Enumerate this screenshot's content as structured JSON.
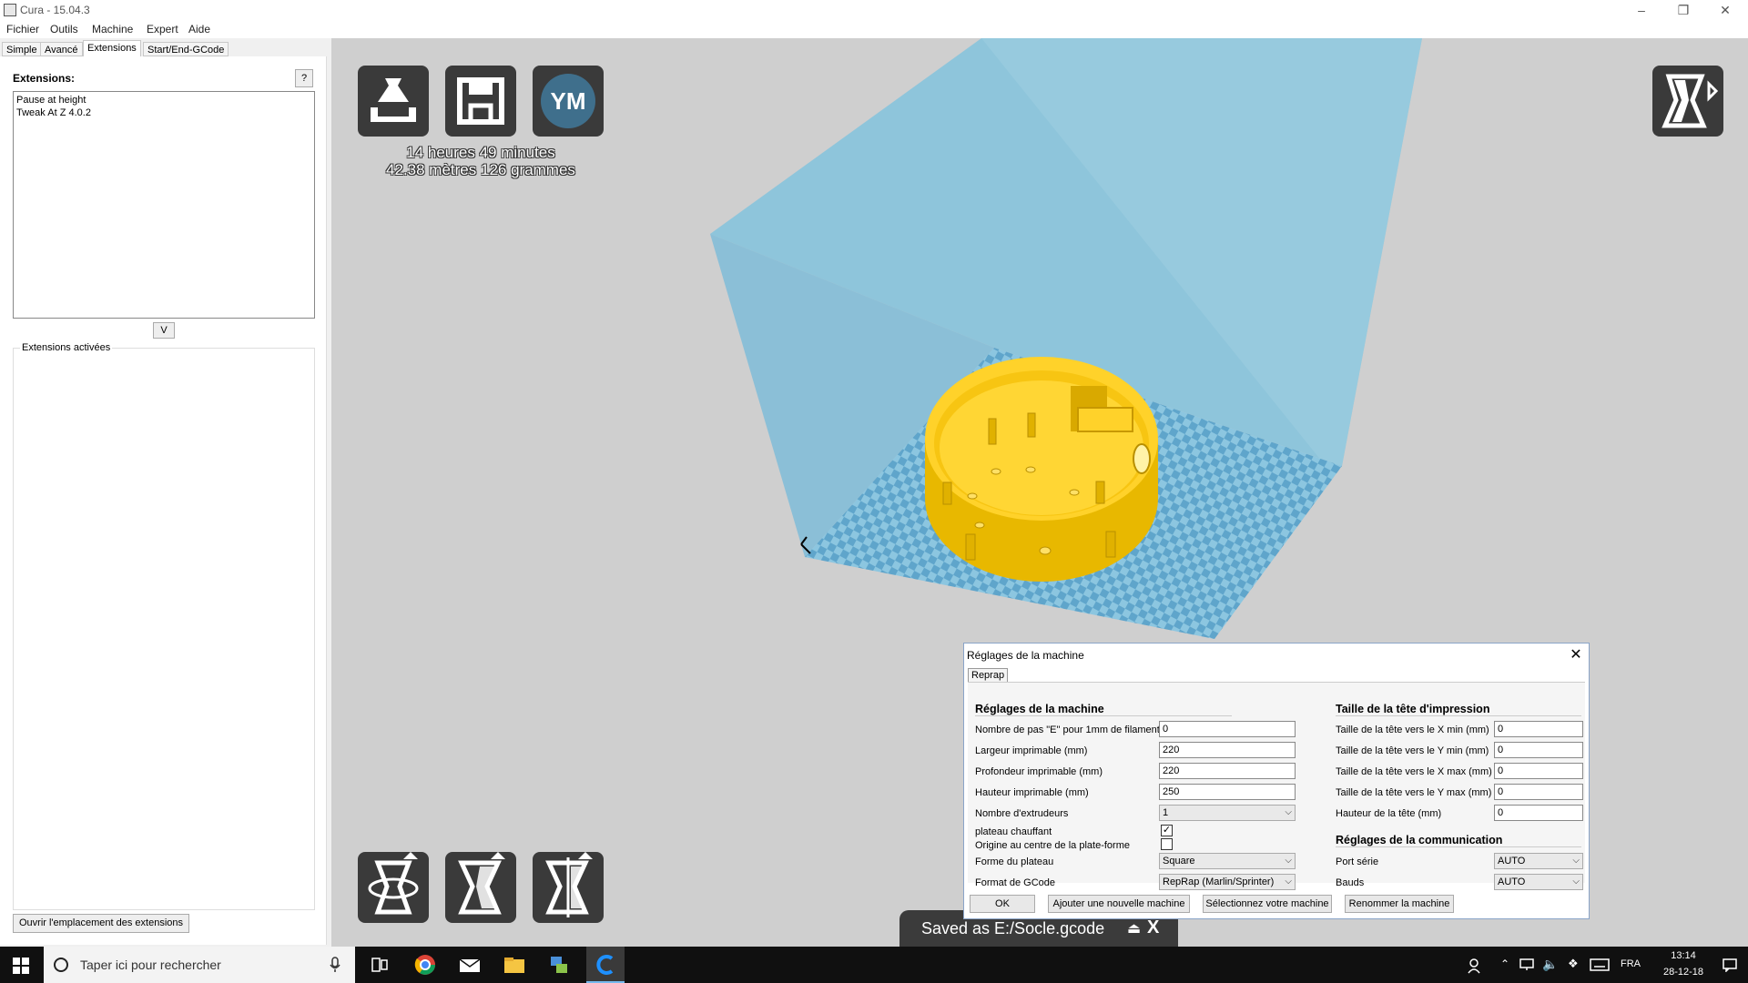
{
  "window": {
    "title": "Cura - 15.04.3"
  },
  "menu": [
    "Fichier",
    "Outils",
    "Machine",
    "Expert",
    "Aide"
  ],
  "tabs": [
    "Simple",
    "Avancé",
    "Extensions",
    "Start/End-GCode"
  ],
  "left_panel": {
    "extensions_label": "Extensions:",
    "help_label": "?",
    "extensions": [
      "Pause at height",
      "Tweak At Z 4.0.2"
    ],
    "move_label": "V",
    "active_title": "Extensions activées",
    "open_location_label": "Ouvrir l'emplacement des extensions"
  },
  "viewport": {
    "ym_label": "YM",
    "print_time": "14 heures 49 minutes",
    "print_material": "42.38 mètres 126 grammes"
  },
  "dialog": {
    "title": "Réglages de la machine",
    "close_label": "✕",
    "tab": "Reprap",
    "machine_section": "Réglages de la machine",
    "head_section": "Taille de la tête d'impression",
    "comm_section": "Réglages de la communication",
    "machine_fields": [
      {
        "label": "Nombre de pas \"E\" pour 1mm de filament",
        "value": "0"
      },
      {
        "label": "Largeur imprimable (mm)",
        "value": "220"
      },
      {
        "label": "Profondeur imprimable (mm)",
        "value": "220"
      },
      {
        "label": "Hauteur imprimable (mm)",
        "value": "250"
      }
    ],
    "extruders": {
      "label": "Nombre d'extrudeurs",
      "value": "1"
    },
    "heated_bed": {
      "label": "plateau chauffant",
      "checked": true
    },
    "origin_center": {
      "label": "Origine au centre de la plate-forme",
      "checked": false
    },
    "bed_shape": {
      "label": "Forme du plateau",
      "value": "Square"
    },
    "gcode_flavor": {
      "label": "Format de GCode",
      "value": "RepRap (Marlin/Sprinter)"
    },
    "head_fields": [
      {
        "label": "Taille de la tête vers le X min (mm)",
        "value": "0"
      },
      {
        "label": "Taille de la tête vers le Y min (mm)",
        "value": "0"
      },
      {
        "label": "Taille de la tête vers le X max (mm)",
        "value": "0"
      },
      {
        "label": "Taille de la tête vers le Y max (mm)",
        "value": "0"
      },
      {
        "label": "Hauteur de la tête (mm)",
        "value": "0"
      }
    ],
    "serial_port": {
      "label": "Port série",
      "value": "AUTO"
    },
    "baud": {
      "label": "Bauds",
      "value": "AUTO"
    },
    "buttons": {
      "ok": "OK",
      "add": "Ajouter une nouvelle machine",
      "select": "Sélectionnez votre machine",
      "rename": "Renommer la machine"
    }
  },
  "toast": {
    "text": "Saved as E:/Socle.gcode",
    "eject": "⏏",
    "close": "X"
  },
  "taskbar": {
    "search_placeholder": "Taper ici pour rechercher",
    "language": "FRA",
    "time": "13:14",
    "date": "28-12-18"
  },
  "colors": {
    "build_volume": "#7fbfdc",
    "bed_checker": "#6aaed0",
    "model": "#ffd22a",
    "tool_button": "#3a3a3a"
  }
}
